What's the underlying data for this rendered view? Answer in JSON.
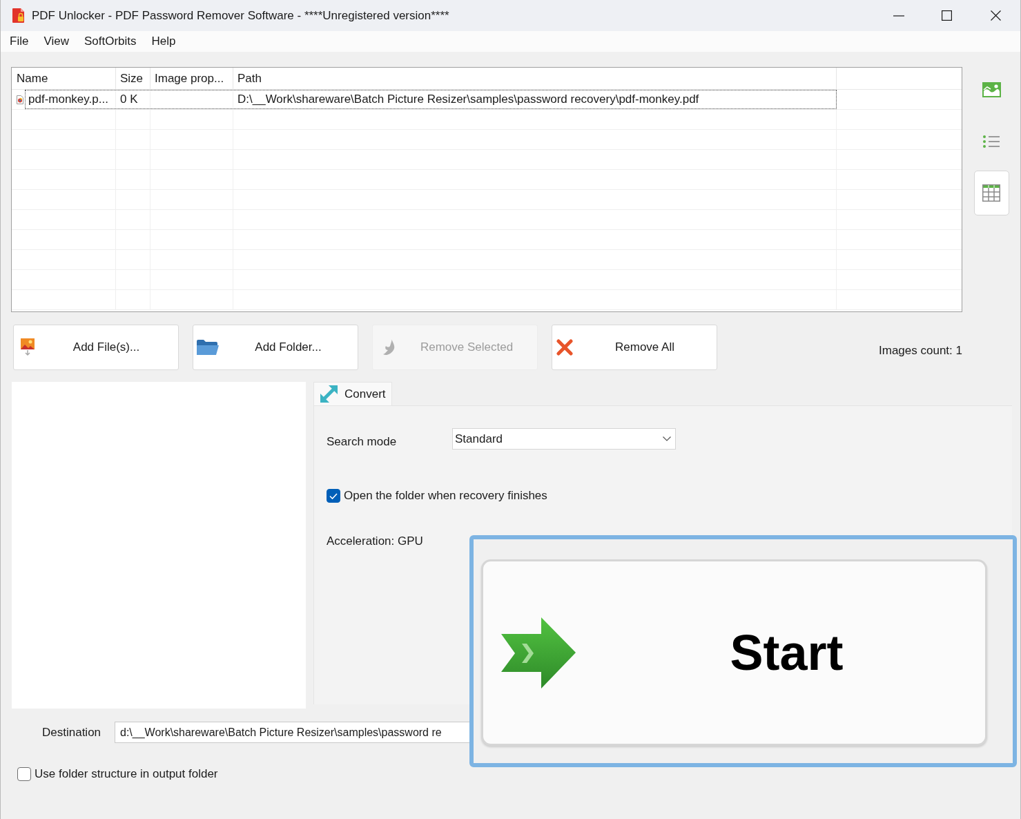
{
  "window": {
    "title": "PDF Unlocker - PDF Password Remover Software - ****Unregistered version****"
  },
  "menu": [
    "File",
    "View",
    "SoftOrbits",
    "Help"
  ],
  "file_table": {
    "columns": [
      "Name",
      "Size",
      "Image prop...",
      "Path"
    ],
    "rows": [
      {
        "name": "pdf-monkey.p...",
        "size": "0 K",
        "path": "D:\\__Work\\shareware\\Batch Picture Resizer\\samples\\password recovery\\pdf-monkey.pdf",
        "selected": true
      }
    ]
  },
  "view_buttons": [
    {
      "kind": "thumbnails",
      "selected": false
    },
    {
      "kind": "list",
      "selected": false
    },
    {
      "kind": "table",
      "selected": true
    }
  ],
  "file_buttons": [
    {
      "kind": "add_files",
      "label": "Add File(s)...",
      "disabled": false
    },
    {
      "kind": "add_folder",
      "label": "Add Folder...",
      "disabled": false
    },
    {
      "kind": "remove_selected",
      "label": "Remove Selected",
      "disabled": true
    },
    {
      "kind": "remove_all",
      "label": "Remove All",
      "disabled": false
    }
  ],
  "images_count": "Images count: 1",
  "tabs": [
    {
      "label": "Convert",
      "selected": true
    }
  ],
  "settings": {
    "search_mode": {
      "label": "Search mode",
      "value": "Standard"
    },
    "open_folder": {
      "label": "Open the folder when recovery finishes",
      "checked": true
    },
    "acceleration": "Acceleration: GPU"
  },
  "start_button": {
    "label": "Start"
  },
  "destination": {
    "label": "Destination",
    "value": "d:\\__Work\\shareware\\Batch Picture Resizer\\samples\\password re"
  },
  "folder_structure": {
    "label": "Use folder structure in output folder",
    "checked": false
  }
}
